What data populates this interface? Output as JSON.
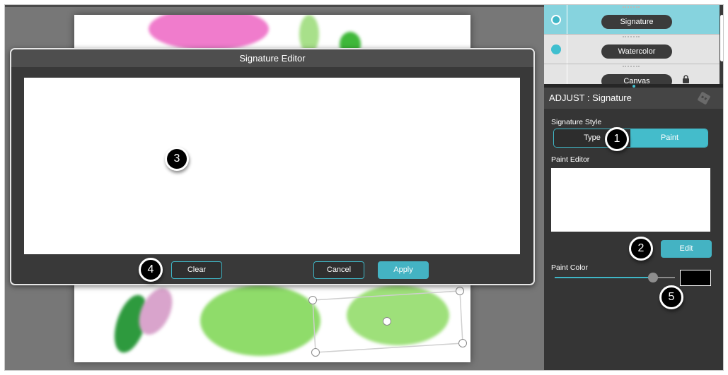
{
  "layers": [
    {
      "name": "Signature",
      "active": true,
      "indicator": "hollow",
      "locked": false
    },
    {
      "name": "Watercolor",
      "active": false,
      "indicator": "filled",
      "locked": false
    },
    {
      "name": "Canvas",
      "active": false,
      "indicator": "none",
      "locked": true
    }
  ],
  "adjust_panel": {
    "title": "ADJUST : Signature",
    "signature_style_label": "Signature Style",
    "style_options": [
      "Type",
      "Paint"
    ],
    "selected_style": "Paint",
    "paint_editor_label": "Paint Editor",
    "edit_button": "Edit",
    "paint_color_label": "Paint Color",
    "paint_color_slider_value": 0.82,
    "paint_color": "#000000"
  },
  "dialog": {
    "title": "Signature Editor",
    "clear_button": "Clear",
    "cancel_button": "Cancel",
    "apply_button": "Apply"
  },
  "callouts": [
    "1",
    "2",
    "3",
    "4",
    "5"
  ],
  "colors": {
    "accent": "#44b3c3",
    "active_layer_bg": "#86d3de",
    "panel_bg": "#353535"
  }
}
